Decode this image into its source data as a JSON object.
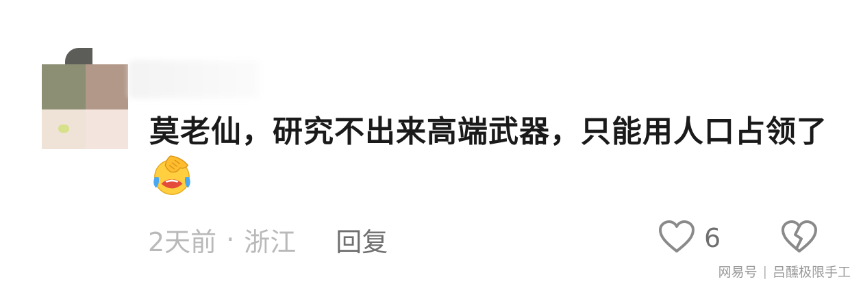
{
  "comment": {
    "text": "莫老仙，研究不出来高端武器，只能用人口占领了",
    "emoji": "face-palm-crying-laughing"
  },
  "meta": {
    "time": "2天前",
    "separator": "·",
    "location": "浙江",
    "reply_label": "回复"
  },
  "actions": {
    "like_count": "6"
  },
  "watermark": {
    "source": "网易号",
    "divider": "|",
    "author": "吕醺极限手工"
  },
  "colors": {
    "text": "#1a1a1a",
    "meta": "#b9b9b9",
    "reply": "#6f6f6f",
    "icon": "#8a8a8a"
  }
}
